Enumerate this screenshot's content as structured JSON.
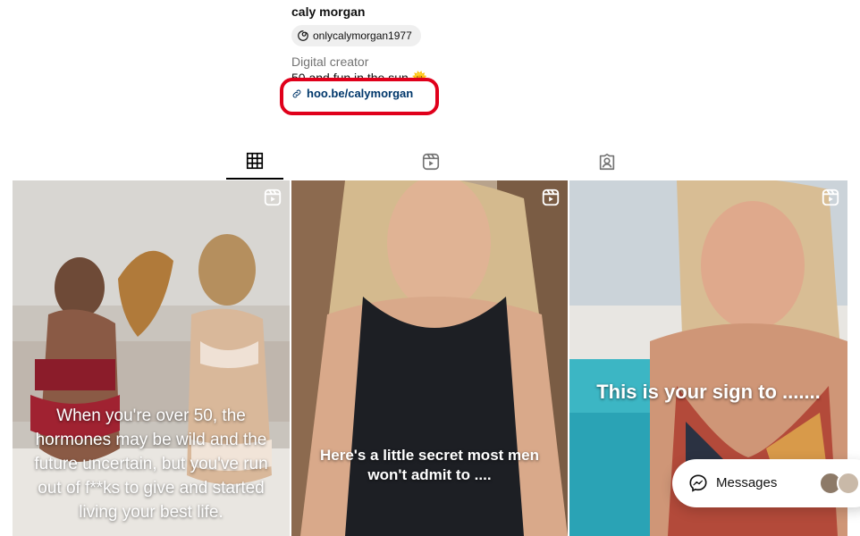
{
  "profile": {
    "username": "caly morgan",
    "threads_handle": "onlycalymorgan1977",
    "category": "Digital creator",
    "bio": "50 and fun in the sun 🌞",
    "link": "hoo.be/calymorgan"
  },
  "tabs": [
    {
      "name": "posts",
      "icon": "grid-icon",
      "active": true
    },
    {
      "name": "reels",
      "icon": "reels-icon",
      "active": false
    },
    {
      "name": "tagged",
      "icon": "tagged-icon",
      "active": false
    }
  ],
  "posts": [
    {
      "caption": "When you're over 50, the hormones may be wild and the future uncertain, but you've run out of f**ks to give and started living your best life.",
      "icon": "reel-icon"
    },
    {
      "caption": "Here's a little secret most men won't admit to ....",
      "icon": "reel-icon"
    },
    {
      "caption": "This is your sign to .......",
      "icon": "reel-icon"
    }
  ],
  "messages": {
    "label": "Messages",
    "icon": "messenger-icon"
  },
  "colors": {
    "link": "#00376b",
    "highlight": "#e0001b",
    "secondary_text": "#737373"
  }
}
